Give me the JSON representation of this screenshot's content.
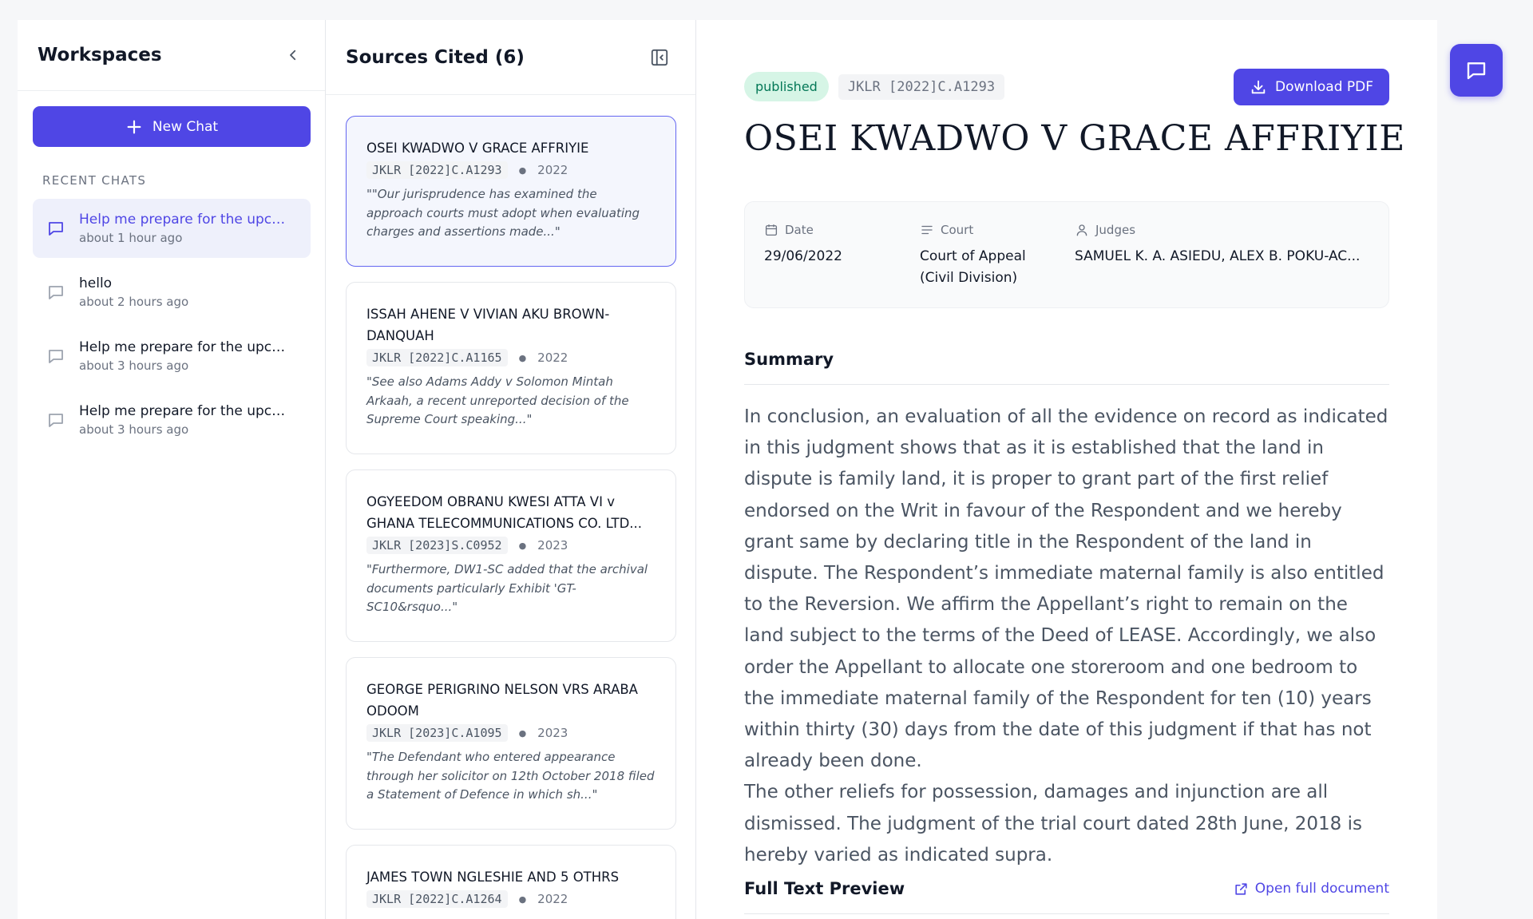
{
  "sidebar": {
    "title": "Workspaces",
    "new_chat_label": "New Chat",
    "recent_label": "RECENT CHATS",
    "chats": [
      {
        "title": "Help me prepare for the upcoming hearing",
        "time": "about 1 hour ago"
      },
      {
        "title": "hello",
        "time": "about 2 hours ago"
      },
      {
        "title": "Help me prepare for the upcoming hearing",
        "time": "about 3 hours ago"
      },
      {
        "title": "Help me prepare for the upcoming hearing",
        "time": "about 3 hours ago"
      }
    ]
  },
  "sources": {
    "title": "Sources Cited (6)",
    "items": [
      {
        "title": "OSEI KWADWO V GRACE AFFRIYIE",
        "citation": "JKLR [2022]C.A1293",
        "year": "2022",
        "excerpt": "\"\"Our jurisprudence has examined the approach courts must adopt when evaluating charges and assertions made...\""
      },
      {
        "title": "ISSAH AHENE V VIVIAN AKU BROWN-DANQUAH",
        "citation": "JKLR [2022]C.A1165",
        "year": "2022",
        "excerpt": "\"See also Adams Addy v Solomon Mintah Arkaah, a recent unreported decision of the Supreme Court speaking...\""
      },
      {
        "title": "OGYEEDOM OBRANU KWESI ATTA VI v GHANA TELECOMMUNICATIONS CO. LTD...",
        "citation": "JKLR [2023]S.C0952",
        "year": "2023",
        "excerpt": "\"Furthermore, DW1-SC added that the archival documents particularly Exhibit 'GT-SC10&rsquo...\""
      },
      {
        "title": "GEORGE PERIGRINO NELSON VRS ARABA ODOOM",
        "citation": "JKLR [2023]C.A1095",
        "year": "2023",
        "excerpt": "\"The Defendant who entered appearance through her solicitor on 12th October 2018 filed a Statement of Defence in which sh...\""
      },
      {
        "title": "JAMES TOWN NGLESHIE AND 5 OTHRS",
        "citation": "JKLR [2022]C.A1264",
        "year": "2022",
        "excerpt": ""
      }
    ]
  },
  "document": {
    "status": "published",
    "citation": "JKLR [2022]C.A1293",
    "download_label": "Download PDF",
    "title": "OSEI KWADWO V GRACE AFFRIYIE",
    "date_label": "Date",
    "date_value": "29/06/2022",
    "court_label": "Court",
    "court_value": "Court of Appeal (Civil Division)",
    "judges_label": "Judges",
    "judges_value": "SAMUEL K. A. ASIEDU, ALEX B. POKU-AC...",
    "summary_heading": "Summary",
    "summary_text": "In conclusion, an evaluation of all the evidence on record as indicated in this judgment shows that as it is established that the land in dispute is family land, it is proper to grant part of the first relief endorsed on the Writ in favour of the Respondent and we hereby grant same by declaring title in the Respondent of the land in dispute. The Respondent’s immediate maternal family is also entitled to the Reversion. We affirm the Appellant’s right to remain on the land subject to the terms of the Deed of LEASE. Accordingly, we also order the Appellant to allocate one storeroom and one bedroom to the immediate maternal family of the Respondent for ten (10) years within thirty (30) days from the date of this judgment if that has not already been done.\nThe other reliefs for possession, damages and injunction are all dismissed. The judgment of the trial court dated 28th June, 2018 is hereby varied as indicated supra.",
    "fulltext_heading": "Full Text Preview",
    "open_full_label": "Open full document"
  },
  "colors": {
    "accent": "#4f46e5",
    "published_bg": "#d6f5e6",
    "published_fg": "#047857"
  }
}
